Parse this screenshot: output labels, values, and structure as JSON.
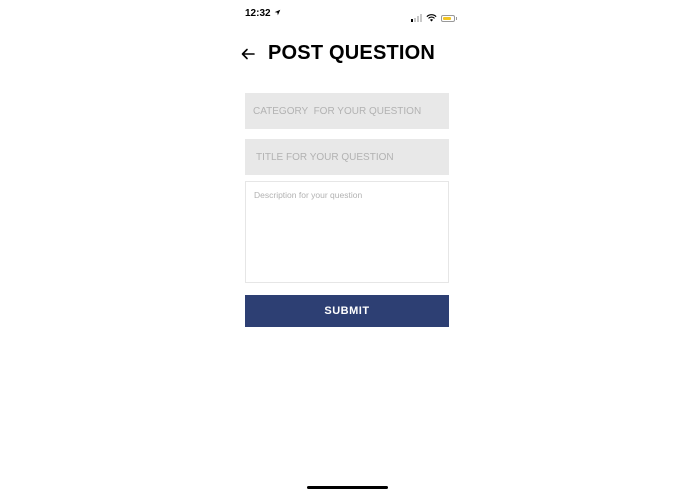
{
  "status_bar": {
    "time": "12:32",
    "location_icon": "location-arrow-icon",
    "signal_icon": "signal-icon",
    "wifi_icon": "wifi-icon",
    "battery_icon": "battery-icon"
  },
  "header": {
    "back_icon": "arrow-left-icon",
    "title": "POST QUESTION"
  },
  "form": {
    "category": {
      "value": "",
      "placeholder": "CATEGORY  FOR YOUR QUESTION"
    },
    "title": {
      "value": "",
      "placeholder": "TITLE FOR YOUR QUESTION"
    },
    "description": {
      "value": "",
      "placeholder": "Description for your question"
    },
    "submit_label": "SUBMIT"
  },
  "colors": {
    "accent": "#2d3f73",
    "field_background": "#e8e8e8",
    "placeholder": "#b2b2b2",
    "battery": "#f2c523"
  }
}
